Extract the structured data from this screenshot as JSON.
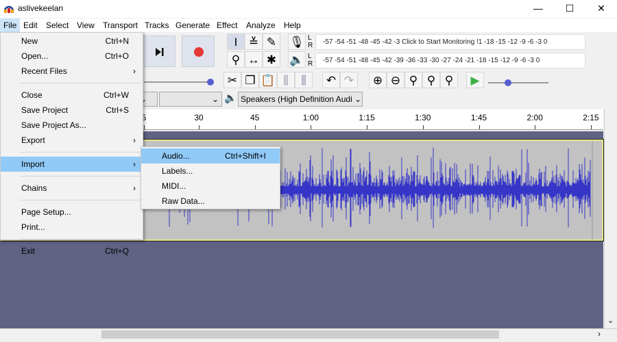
{
  "window": {
    "title": "aslivekeelan",
    "minimize": "—",
    "maximize": "☐",
    "close": "✕"
  },
  "menubar": [
    "File",
    "Edit",
    "Select",
    "View",
    "Transport",
    "Tracks",
    "Generate",
    "Effect",
    "Analyze",
    "Help"
  ],
  "file_menu": [
    {
      "label": "New",
      "shortcut": "Ctrl+N"
    },
    {
      "label": "Open...",
      "shortcut": "Ctrl+O"
    },
    {
      "label": "Recent Files",
      "submenu": true
    },
    {
      "separator": true
    },
    {
      "label": "Close",
      "shortcut": "Ctrl+W"
    },
    {
      "label": "Save Project",
      "shortcut": "Ctrl+S"
    },
    {
      "label": "Save Project As..."
    },
    {
      "label": "Export",
      "submenu": true
    },
    {
      "separator": true
    },
    {
      "label": "Import",
      "submenu": true,
      "highlighted": true
    },
    {
      "separator": true
    },
    {
      "label": "Chains",
      "submenu": true
    },
    {
      "separator": true
    },
    {
      "label": "Page Setup..."
    },
    {
      "label": "Print..."
    },
    {
      "separator": true
    },
    {
      "label": "Exit",
      "shortcut": "Ctrl+Q"
    }
  ],
  "import_submenu": [
    {
      "label": "Audio...",
      "shortcut": "Ctrl+Shift+I",
      "highlighted": true
    },
    {
      "label": "Labels..."
    },
    {
      "label": "MIDI..."
    },
    {
      "label": "Raw Data..."
    }
  ],
  "meters": {
    "record_text": "-57 -54 -51 -48 -45 -42 -3 Click to Start Monitoring !1 -18 -15 -12 -9 -6 -3 0",
    "play_text": "-57 -54 -51 -48 -45 -42 -39 -36 -33 -30 -27 -24 -21 -18 -15 -12 -9 -6 -3 0",
    "channels": [
      "L",
      "R"
    ]
  },
  "devices": {
    "output": "Speakers (High Definition Audi"
  },
  "ruler": {
    "labels": [
      "5",
      "30",
      "45",
      "1:00",
      "1:15",
      "1:30",
      "1:45",
      "2:00",
      "2:15"
    ]
  },
  "colors": {
    "waveform": "#3535c8",
    "track_bg": "#c2c2c2",
    "background": "#5f6282",
    "menu_highlight": "#91c9f7",
    "record": "#e53935",
    "play": "#3cb043"
  }
}
